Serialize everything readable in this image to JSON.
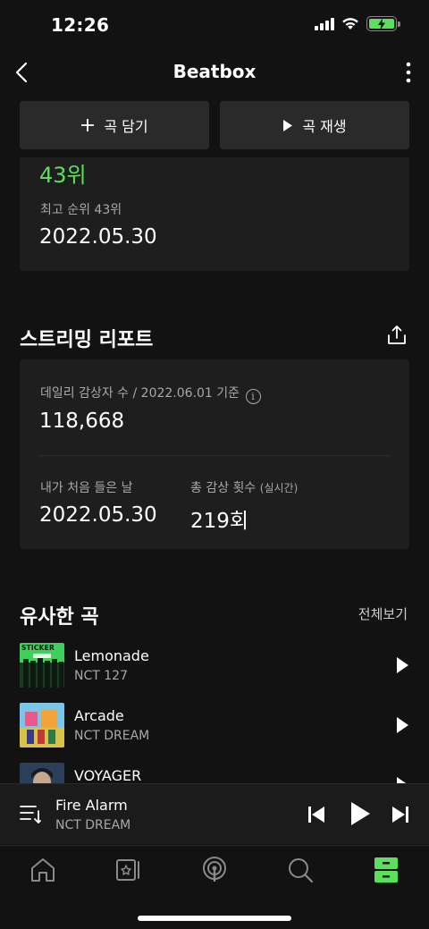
{
  "status": {
    "time": "12:26"
  },
  "nav": {
    "title": "Beatbox"
  },
  "actions": {
    "add_label": "곡 담기",
    "play_label": "곡 재생"
  },
  "rank": {
    "current": "43위",
    "best_label": "최고 순위 43위",
    "best_date": "2022.05.30"
  },
  "streaming": {
    "title": "스트리밍 리포트",
    "daily_label": "데일리 감상자 수 / 2022.06.01 기준",
    "daily_value": "118,668",
    "first_listen_label": "내가 처음 들은 날",
    "first_listen_value": "2022.05.30",
    "total_plays_label": "총 감상 횟수",
    "total_plays_realtime": "(실시간)",
    "total_plays_value": "219회"
  },
  "similar": {
    "title": "유사한 곡",
    "see_all": "전체보기",
    "tracks": [
      {
        "title": "Lemonade",
        "artist": "NCT 127",
        "art_text": "STICKER"
      },
      {
        "title": "Arcade",
        "artist": "NCT DREAM"
      },
      {
        "title": "VOYAGER",
        "artist": ""
      }
    ]
  },
  "player": {
    "title": "Fire Alarm",
    "artist": "NCT DREAM"
  },
  "tabs": [
    "home-icon",
    "library-card-icon",
    "podcast-icon",
    "search-icon",
    "storage-icon"
  ],
  "colors": {
    "accent": "#5ae05a",
    "background": "#121212",
    "card": "#1e1e1e"
  }
}
